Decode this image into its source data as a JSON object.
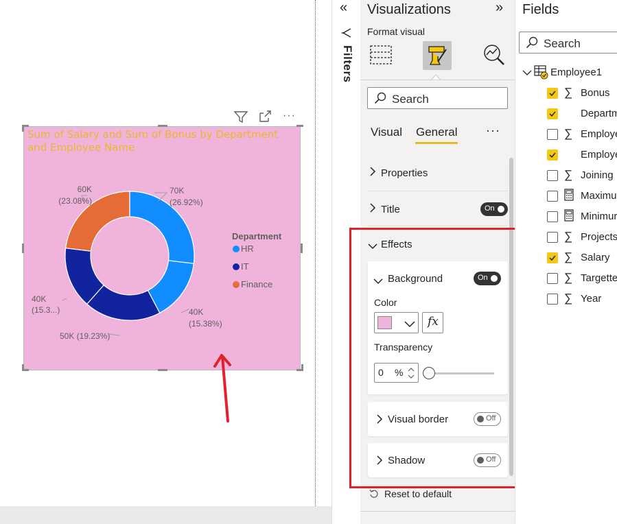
{
  "chart_data": {
    "type": "donut",
    "title": "Sum of Salary and Sum of Bonus by Department and Employee Name",
    "legend": {
      "title": "Department",
      "position": "right",
      "items": [
        {
          "name": "HR",
          "color": "#118dff"
        },
        {
          "name": "IT",
          "color": "#12239e"
        },
        {
          "name": "Finance",
          "color": "#e66c37"
        }
      ]
    },
    "slices": [
      {
        "department": "HR",
        "value": 70000,
        "percent": 26.92,
        "label": "70K",
        "pct_label": "(26.92%)",
        "color": "#118dff"
      },
      {
        "department": "HR",
        "value": 40000,
        "percent": 15.38,
        "label": "40K",
        "pct_label": "(15.38%)",
        "color": "#118dff"
      },
      {
        "department": "IT",
        "value": 50000,
        "percent": 19.23,
        "label": "50K (19.23%)",
        "pct_label": "",
        "color": "#12239e"
      },
      {
        "department": "IT",
        "value": 40000,
        "percent": 15.38,
        "label": "40K",
        "pct_label": "(15.3...)",
        "color": "#12239e"
      },
      {
        "department": "Finance",
        "value": 60000,
        "percent": 23.08,
        "label": "60K",
        "pct_label": "(23.08%)",
        "color": "#e66c37"
      }
    ],
    "background": "#f0b4dc",
    "title_color": "#e8b82c"
  },
  "visual_header": {
    "icons": [
      "filter-icon",
      "focus-mode-icon",
      "more-options-icon"
    ],
    "more": "···"
  },
  "filters_pane": {
    "label": "Filters",
    "collapse_icon": "«"
  },
  "visualizations": {
    "title": "Visualizations",
    "expand_icon": "»",
    "format_visual_label": "Format visual",
    "search_placeholder": "Search",
    "tabs": [
      {
        "label": "Visual"
      },
      {
        "label": "General",
        "active": true
      }
    ],
    "more": "···",
    "sections": {
      "properties": "Properties",
      "title": "Title",
      "title_toggle": "On",
      "effects": "Effects",
      "background": "Background",
      "background_toggle": "On",
      "color_label": "Color",
      "color_value": "#f0b4dc",
      "fx": "fx",
      "transparency_label": "Transparency",
      "transparency_value": "0",
      "transparency_unit": "%",
      "transparency_fraction": 0.0,
      "visual_border": "Visual border",
      "visual_border_toggle": "Off",
      "shadow": "Shadow",
      "shadow_toggle": "Off"
    },
    "reset_label": "Reset to default"
  },
  "fields": {
    "title": "Fields",
    "search_placeholder": "Search",
    "table_name": "Employee1",
    "items": [
      {
        "name": "Bonus",
        "checked": true,
        "icon": "sigma"
      },
      {
        "name": "Departm",
        "checked": true,
        "icon": "none"
      },
      {
        "name": "Employe",
        "checked": false,
        "icon": "sigma"
      },
      {
        "name": "Employe",
        "checked": true,
        "icon": "none"
      },
      {
        "name": "Joining I",
        "checked": false,
        "icon": "sigma"
      },
      {
        "name": "Maximu",
        "checked": false,
        "icon": "calculator"
      },
      {
        "name": "Minimur",
        "checked": false,
        "icon": "calculator"
      },
      {
        "name": "Projects",
        "checked": false,
        "icon": "sigma"
      },
      {
        "name": "Salary",
        "checked": true,
        "icon": "sigma"
      },
      {
        "name": "Targette",
        "checked": false,
        "icon": "sigma"
      },
      {
        "name": "Year",
        "checked": false,
        "icon": "sigma"
      }
    ]
  },
  "colors": {
    "accent": "#e8b82c",
    "annotation": "#e3212b",
    "checkbox": "#f2c811"
  }
}
